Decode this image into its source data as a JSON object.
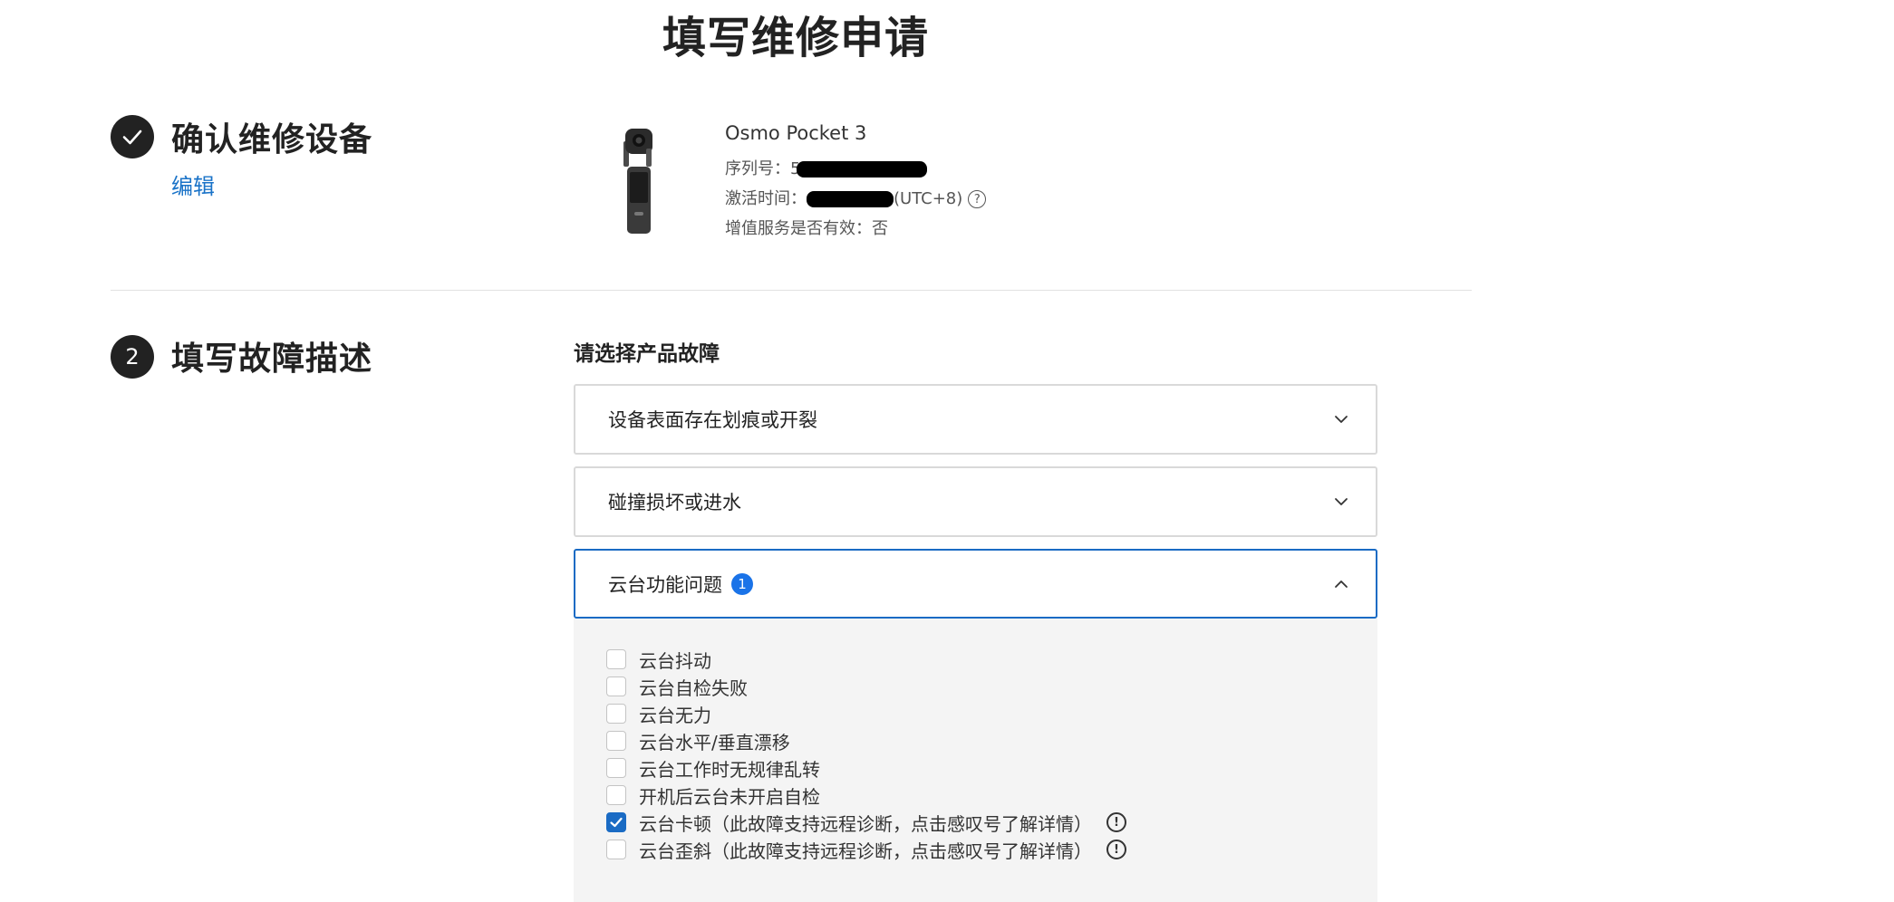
{
  "page": {
    "title": "填写维修申请"
  },
  "step1": {
    "number_icon": "check-icon",
    "heading": "确认维修设备",
    "edit_label": "编辑"
  },
  "device": {
    "image_icon": "camera-gimbal-icon",
    "name": "Osmo Pocket 3",
    "serial_label": "序列号：",
    "serial_visible": "5",
    "activation_label": "激活时间：",
    "activation_suffix": "(UTC+8)",
    "activation_help_icon": "question-circle-icon",
    "value_added_label": "增值服务是否有效：",
    "value_added_value": "否"
  },
  "step2": {
    "number": "2",
    "heading": "填写故障描述",
    "section_label": "请选择产品故障",
    "categories": [
      {
        "label": "设备表面存在划痕或开裂",
        "expanded": false
      },
      {
        "label": "碰撞损坏或进水",
        "expanded": false
      },
      {
        "label": "云台功能问题",
        "expanded": true,
        "selected_count": "1"
      }
    ],
    "options": [
      {
        "label": "云台抖动",
        "checked": false,
        "info": false
      },
      {
        "label": "云台自检失败",
        "checked": false,
        "info": false
      },
      {
        "label": "云台无力",
        "checked": false,
        "info": false
      },
      {
        "label": "云台水平/垂直漂移",
        "checked": false,
        "info": false
      },
      {
        "label": "云台工作时无规律乱转",
        "checked": false,
        "info": false
      },
      {
        "label": "开机后云台未开启自检",
        "checked": false,
        "info": false
      },
      {
        "label": "云台卡顿（此故障支持远程诊断，点击感叹号了解详情）",
        "checked": true,
        "info": true
      },
      {
        "label": "云台歪斜（此故障支持远程诊断，点击感叹号了解详情）",
        "checked": false,
        "info": true
      }
    ]
  },
  "colors": {
    "accent": "#1a6bc4",
    "badge": "#1a73e8",
    "dark": "#222222",
    "panel": "#f4f4f4"
  }
}
